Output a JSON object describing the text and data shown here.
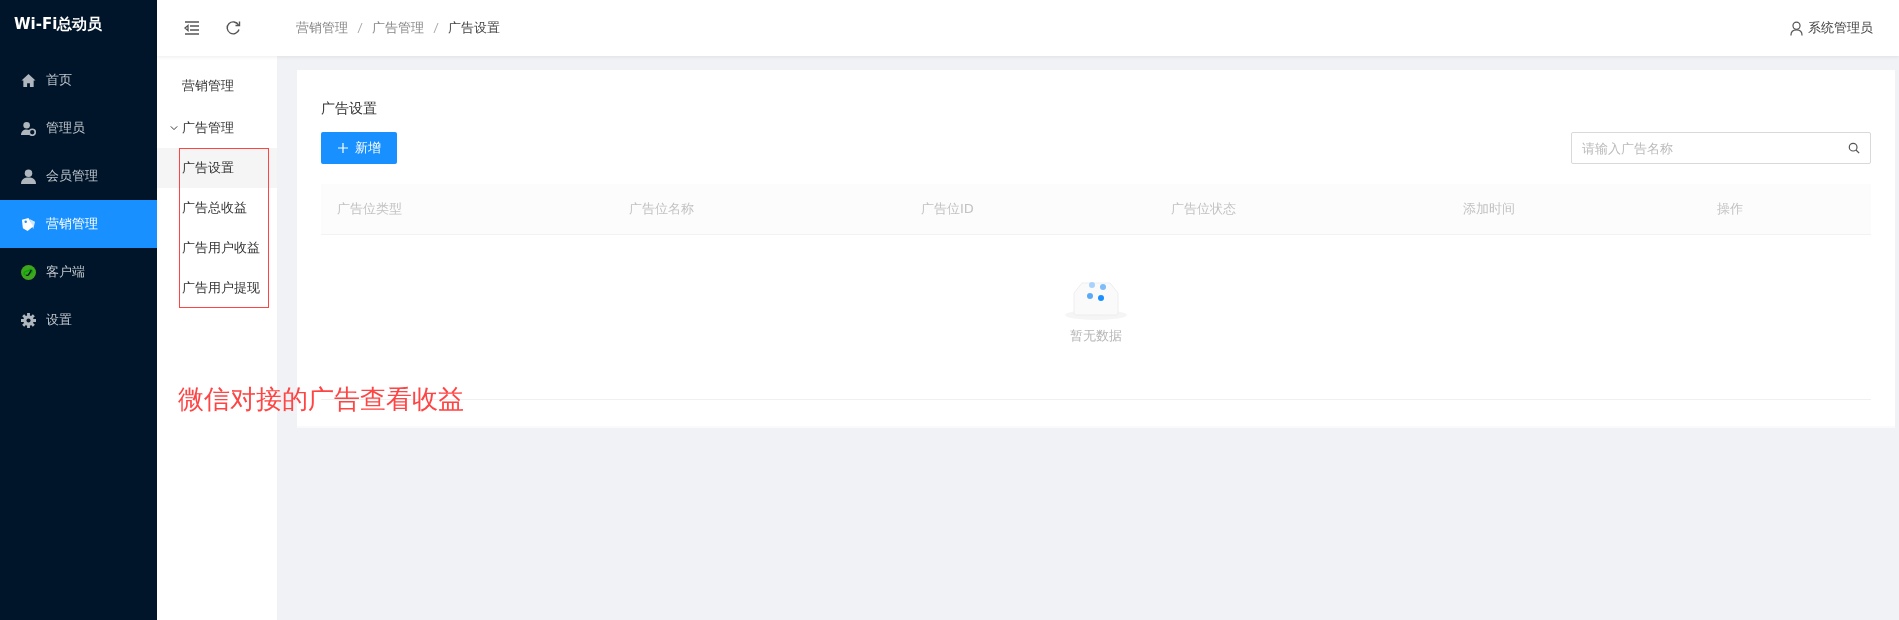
{
  "brand": "Wi-Fi总动员",
  "sidebar": {
    "items": [
      {
        "label": "首页",
        "selected": false
      },
      {
        "label": "管理员",
        "selected": false
      },
      {
        "label": "会员管理",
        "selected": false
      },
      {
        "label": "营销管理",
        "selected": true
      },
      {
        "label": "客户端",
        "selected": false
      },
      {
        "label": "设置",
        "selected": false
      }
    ]
  },
  "breadcrumb": [
    "营销管理",
    "广告管理",
    "广告设置"
  ],
  "user": "系统管理员",
  "submenu": {
    "title": "营销管理",
    "group": {
      "label": "广告管理",
      "expanded": true,
      "children": [
        {
          "label": "广告设置",
          "selected": true
        },
        {
          "label": "广告总收益",
          "selected": false
        },
        {
          "label": "广告用户收益",
          "selected": false
        },
        {
          "label": "广告用户提现",
          "selected": false
        }
      ]
    }
  },
  "annotation": {
    "text": "微信对接的广告查看收益"
  },
  "card": {
    "title": "广告设置",
    "add_button": "新增",
    "search": {
      "placeholder": "请输入广告名称"
    },
    "table": {
      "columns": [
        "广告位类型",
        "广告位名称",
        "广告位ID",
        "广告位状态",
        "添加时间",
        "操作"
      ],
      "empty_text": "暂无数据"
    }
  }
}
